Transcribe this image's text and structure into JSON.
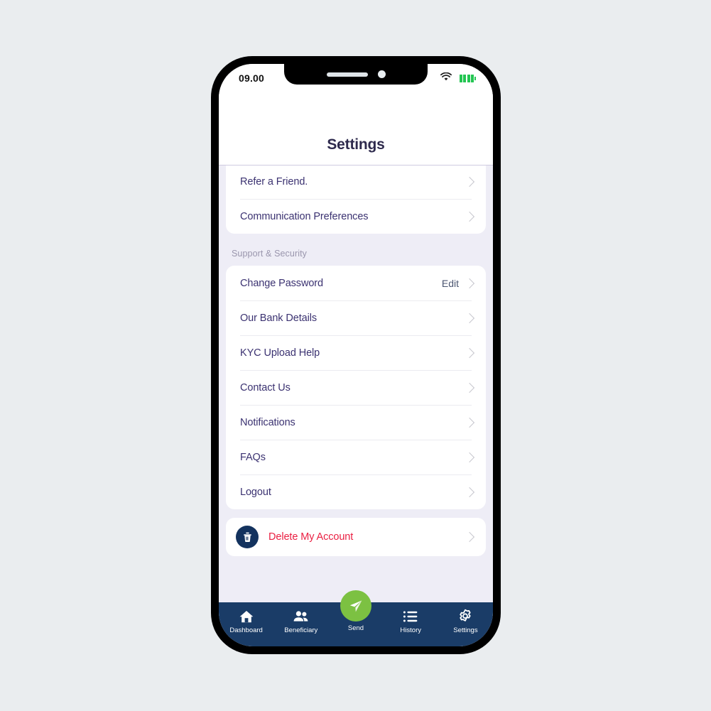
{
  "statusbar": {
    "time": "09.00",
    "wifi_icon": "wifi-icon",
    "battery_icon": "battery-icon",
    "battery_bars": 4,
    "battery_color": "#23c552"
  },
  "header": {
    "title": "Settings"
  },
  "colors": {
    "page_background": "#eaedef",
    "screen_background": "#eeedf6",
    "card": "#ffffff",
    "title_text": "#2e2a4d",
    "row_text": "#3b3271",
    "section_text": "#9a96ad",
    "chevron": "#c7c7ce",
    "nav_background": "#1a3c67",
    "send_accent": "#7cc142",
    "delete_text": "#ea1f42",
    "trash_badge": "#13325e"
  },
  "sections": [
    {
      "name": "account-card",
      "header": null,
      "clipped_top": true,
      "rows": [
        {
          "label": "Refer a Friend.",
          "action": null,
          "chevron": true
        },
        {
          "label": "Communication Preferences",
          "action": null,
          "chevron": true
        }
      ]
    },
    {
      "name": "support-security-card",
      "header": "Support & Security",
      "clipped_top": false,
      "rows": [
        {
          "label": "Change Password",
          "action": "Edit",
          "chevron": true
        },
        {
          "label": "Our Bank Details",
          "action": null,
          "chevron": true
        },
        {
          "label": "KYC Upload Help",
          "action": null,
          "chevron": true
        },
        {
          "label": "Contact Us",
          "action": null,
          "chevron": true
        },
        {
          "label": "Notifications",
          "action": null,
          "chevron": true
        },
        {
          "label": "FAQs",
          "action": null,
          "chevron": true
        },
        {
          "label": "Logout",
          "action": null,
          "chevron": true
        }
      ]
    }
  ],
  "delete_account": {
    "label": "Delete My Account",
    "icon": "trash-icon",
    "chevron": true
  },
  "bottom_nav": {
    "items": [
      {
        "label": "Dashboard",
        "icon": "home-icon",
        "active": false
      },
      {
        "label": "Beneficiary",
        "icon": "people-icon",
        "active": false
      },
      {
        "label": "Send",
        "icon": "paper-plane-icon",
        "active": true
      },
      {
        "label": "History",
        "icon": "list-icon",
        "active": false
      },
      {
        "label": "Settings",
        "icon": "gear-icon",
        "active": true
      }
    ]
  }
}
